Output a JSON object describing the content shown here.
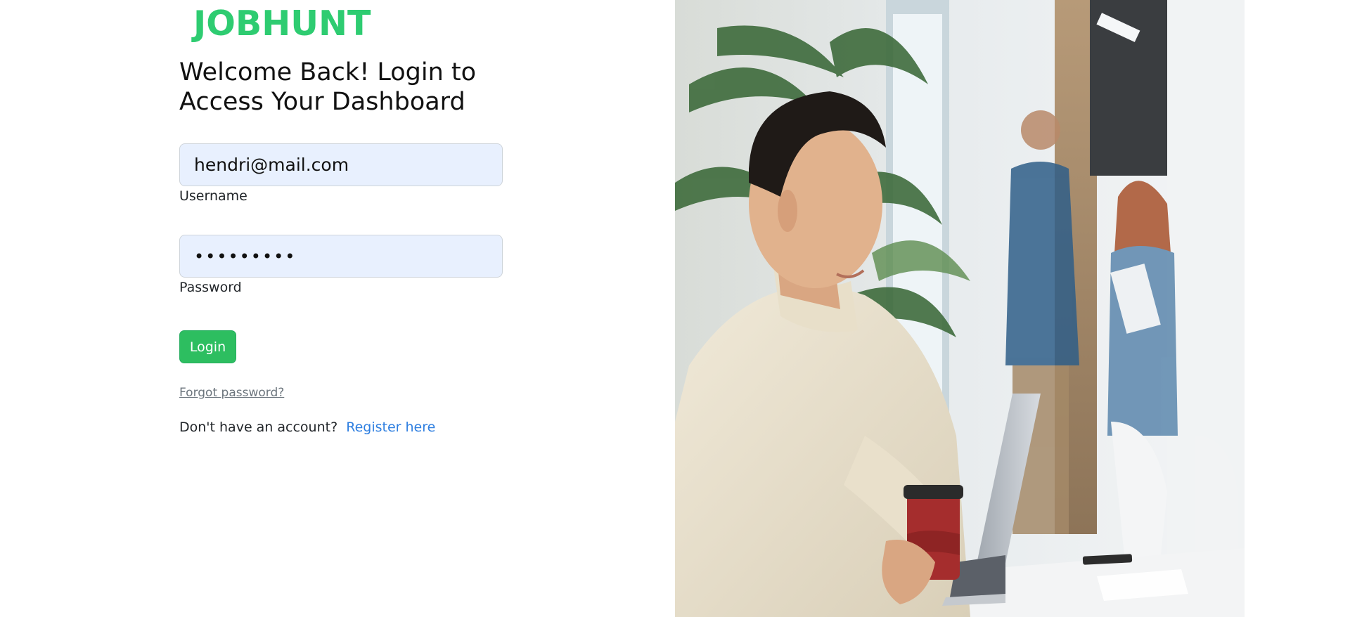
{
  "brand": {
    "logo_text": "JOBHUNT",
    "logo_color": "#2ecc71"
  },
  "login": {
    "heading": "Welcome Back! Login to Access Your Dashboard",
    "username": {
      "value": "hendri@mail.com",
      "label": "Username"
    },
    "password": {
      "value": "•••••••••",
      "label": "Password"
    },
    "login_button": "Login",
    "forgot_link": "Forgot password?",
    "register_prompt": "Don't have an account?",
    "register_link": "Register here",
    "accent_color": "#2dbe60",
    "link_color": "#2f7fe0"
  },
  "photo": {
    "subject": "man-with-laptop-and-coffee-in-office"
  }
}
